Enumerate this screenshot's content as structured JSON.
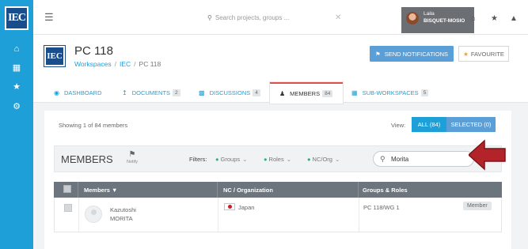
{
  "rail": {
    "logo": "IEC",
    "icons": [
      "home-icon",
      "calendar-icon",
      "star-icon",
      "gear-icon"
    ]
  },
  "topbar": {
    "search_placeholder": "Search projects, groups ...",
    "user_first": "Laila",
    "user_last": "BISQUET-MOSIO"
  },
  "header": {
    "logo": "IEC",
    "title": "PC 118",
    "breadcrumbs": [
      "Workspaces",
      "IEC",
      "PC 118"
    ],
    "notify_button": "SEND NOTIFICATIONS",
    "favourite_button": "FAVOURITE"
  },
  "tabs": [
    {
      "label": "DASHBOARD",
      "count": null
    },
    {
      "label": "DOCUMENTS",
      "count": "2"
    },
    {
      "label": "DISCUSSIONS",
      "count": "4"
    },
    {
      "label": "MEMBERS",
      "count": "84"
    },
    {
      "label": "SUB-WORKSPACES",
      "count": "5"
    }
  ],
  "members": {
    "showing": "Showing 1 of 84 members",
    "view_label": "View:",
    "view_all": "ALL (84)",
    "view_selected": "SELECTED (0)",
    "title": "MEMBERS",
    "notify": "Notify",
    "filters_label": "Filters:",
    "filters": [
      "Groups",
      "Roles",
      "NC/Org"
    ],
    "search_value": "Morita",
    "columns": [
      "Members ▼",
      "NC / Organization",
      "Groups & Roles"
    ],
    "rows": [
      {
        "first": "Kazutoshi",
        "last": "MORITA",
        "country": "Japan",
        "group": "PC 118/WG 1",
        "role": "Member"
      }
    ]
  },
  "colors": {
    "rail": "#1f9fd8",
    "accent": "#1f9fd8",
    "button": "#5b9fd8",
    "arrow": "#b2242a",
    "filter_dot": "#2ab27b"
  }
}
